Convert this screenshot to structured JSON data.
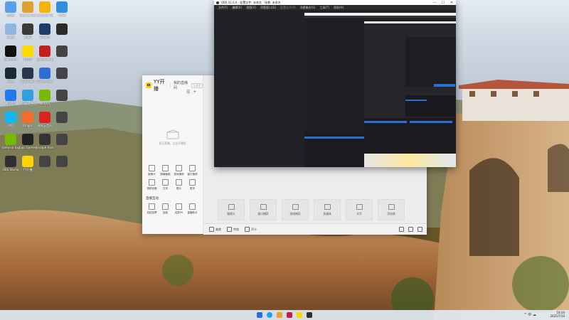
{
  "desktop_icons": [
    {
      "label": "此电脑",
      "color": "#5aa0e8"
    },
    {
      "label": "Counter-Strike 2",
      "color": "#e0a030"
    },
    {
      "label": "Rockstar Games Launcher",
      "color": "#f4b400"
    },
    {
      "label": "工作台",
      "color": "#2f8fe0"
    },
    {
      "label": "回收站",
      "color": "#8fb6e0"
    },
    {
      "label": "PUBG",
      "color": "#3a3a3a"
    },
    {
      "label": "英雄联盟",
      "color": "#1e3c6a"
    },
    {
      "label": "",
      "color": "#2a2a2a"
    },
    {
      "label": "剪映专业版",
      "color": "#111"
    },
    {
      "label": "QQ音乐",
      "color": "#ffd800"
    },
    {
      "label": "Wallpaper Engine",
      "color": "#c02020"
    },
    {
      "label": "",
      "color": "#444"
    },
    {
      "label": "Steam",
      "color": "#1b2838"
    },
    {
      "label": "VALORANT",
      "color": "#2a3550"
    },
    {
      "label": "英雄联盟WeGame版",
      "color": "#2b6fd0"
    },
    {
      "label": "",
      "color": "#444"
    },
    {
      "label": "腾讯会议",
      "color": "#1f7af0"
    },
    {
      "label": "腾讯桌面整理",
      "color": "#30a0e0"
    },
    {
      "label": "NVIDIA",
      "color": "#76b900"
    },
    {
      "label": "",
      "color": "#444"
    },
    {
      "label": "QQ",
      "color": "#12b7f5"
    },
    {
      "label": "Origin",
      "color": "#f56c2d"
    },
    {
      "label": "网易云音乐",
      "color": "#d8231f"
    },
    {
      "label": "",
      "color": "#444"
    },
    {
      "label": "GeForce Experience",
      "color": "#76b900"
    },
    {
      "label": "Epic Games",
      "color": "#222"
    },
    {
      "label": "Escape from Tarkov",
      "color": "#333"
    },
    {
      "label": "",
      "color": "#444"
    },
    {
      "label": "OBS Studio",
      "color": "#302e31"
    },
    {
      "label": "YY开播",
      "color": "#ffd400"
    },
    {
      "label": "",
      "color": "#444"
    },
    {
      "label": "",
      "color": "#444"
    }
  ],
  "yy_window": {
    "app_name": "YY开播",
    "sub_title": "我的直播间",
    "version": "1.0.0",
    "empty_text": "暂无直播，点击开播吧",
    "tools_row1": [
      "摄像头",
      "屏幕截取",
      "游戏捕获",
      "窗口捕获"
    ],
    "tools_row2": [
      "视频设备",
      "文本",
      "图片",
      "更多"
    ],
    "section_label": "直播互动",
    "tools_row3": [
      "发起投票",
      "抽奖",
      "连麦PK",
      "直播助手"
    ],
    "source_buttons": [
      "摄像头",
      "窗口捕获",
      "游戏捕获",
      "多媒体",
      "文字",
      "添加源"
    ],
    "bottom_bar": [
      "美颜",
      "特效",
      "声卡"
    ]
  },
  "obs_window": {
    "title": "OBS 31.0.0 - 配置文件: 未命名 - 场景: 未命名",
    "menu": [
      "文件(F)",
      "编辑(E)",
      "视图(V)",
      "停靠窗口(D)",
      "配置文件(P)",
      "场景集合(S)",
      "工具(T)",
      "帮助(H)"
    ],
    "window_buttons": [
      "—",
      "☐",
      "✕"
    ]
  },
  "taskbar": {
    "time": "18:34",
    "date": "2025/7/10",
    "tray_text": "^ 中 ☁",
    "app_colors": [
      "#1f6fe0",
      "#1fa0f0",
      "#f0a030",
      "#c02050",
      "#ffd400",
      "#302e31"
    ]
  }
}
